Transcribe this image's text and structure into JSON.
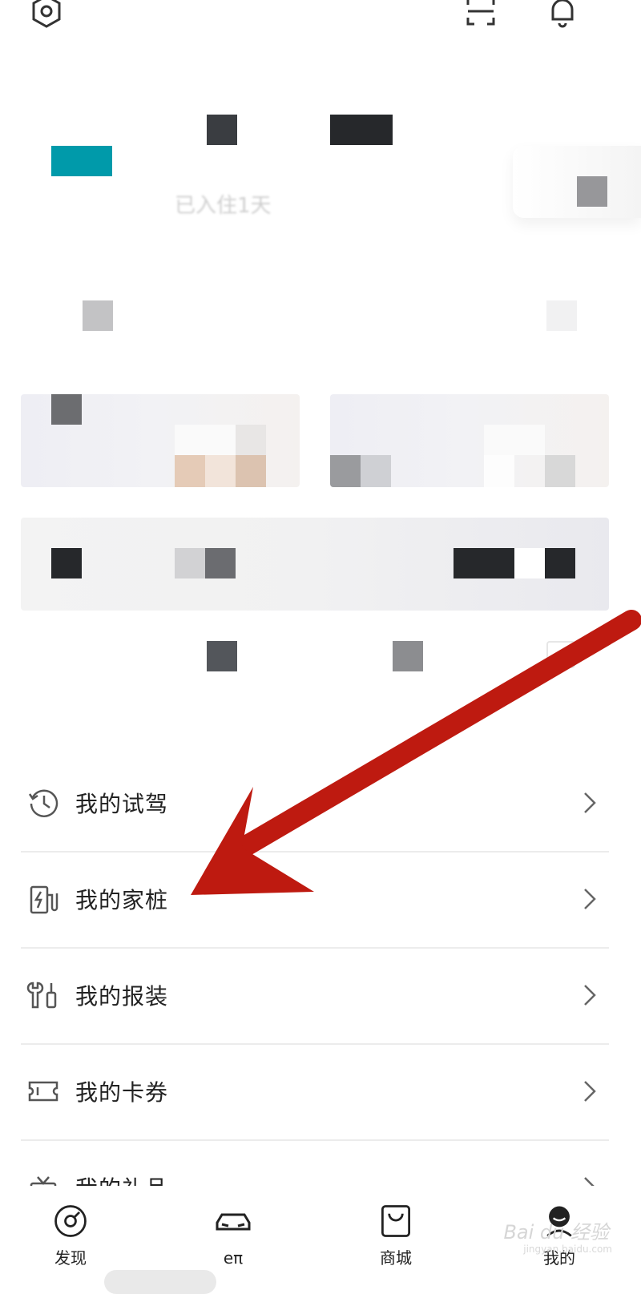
{
  "menu": {
    "items": [
      {
        "label": "我的试驾",
        "icon": "history-clock-icon"
      },
      {
        "label": "我的家桩",
        "icon": "home-charger-icon"
      },
      {
        "label": "我的报装",
        "icon": "install-tools-icon"
      },
      {
        "label": "我的卡券",
        "icon": "coupon-ticket-icon"
      },
      {
        "label": "我的礼品",
        "icon": "gift-icon"
      }
    ]
  },
  "tabbar": {
    "tabs": [
      {
        "label": "发现",
        "icon": "discover-icon"
      },
      {
        "label": "eπ",
        "icon": "car-icon"
      },
      {
        "label": "商城",
        "icon": "shopping-bag-icon"
      },
      {
        "label": "我的",
        "icon": "avatar-icon"
      }
    ]
  },
  "header": {
    "joined_days": "已入住1天"
  },
  "watermark": {
    "text": "Bai du 经验",
    "sub": "jingyan.baidu.com"
  },
  "colors": {
    "accent": "#009aaa",
    "arrow": "#be1a10"
  }
}
